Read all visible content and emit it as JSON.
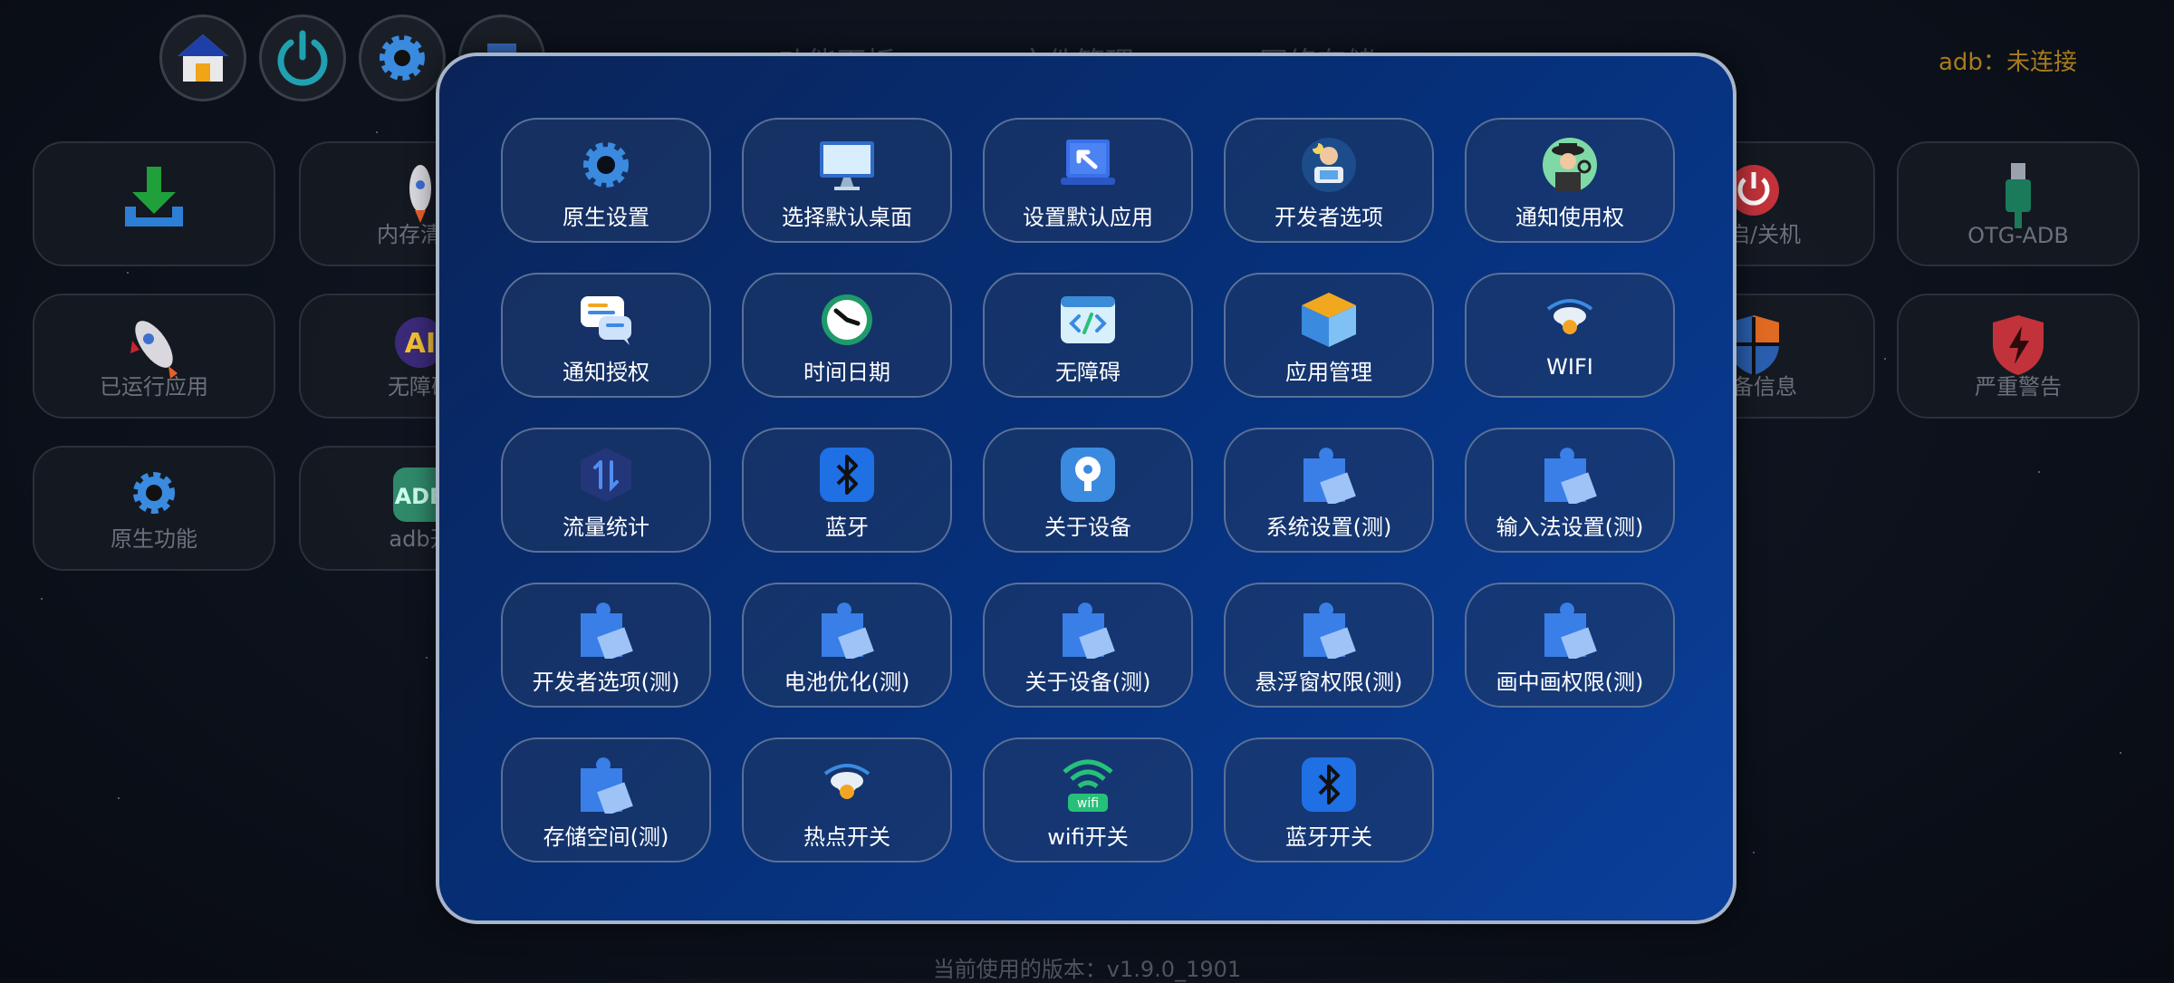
{
  "header": {
    "nav": [
      "功能面板",
      "文件管理",
      "网络存储"
    ],
    "adb_status": "adb：未连接"
  },
  "background_tiles": {
    "download": "",
    "memory_clean": "内存清理",
    "reboot": "重启/关机",
    "otg_adb": "OTG-ADB",
    "running_apps": "已运行应用",
    "accessibility": "无障碍",
    "device_info": "设备信息",
    "severe_warning": "严重警告",
    "native_functions": "原生功能",
    "adb_open": "adb开"
  },
  "modal": {
    "items": [
      {
        "label": "原生设置",
        "icon": "gear-icon"
      },
      {
        "label": "选择默认桌面",
        "icon": "monitor-icon"
      },
      {
        "label": "设置默认应用",
        "icon": "laptop-arrow-icon"
      },
      {
        "label": "开发者选项",
        "icon": "developer-icon"
      },
      {
        "label": "通知使用权",
        "icon": "detective-icon"
      },
      {
        "label": "通知授权",
        "icon": "chat-bubble-icon"
      },
      {
        "label": "时间日期",
        "icon": "clock-icon"
      },
      {
        "label": "无障碍",
        "icon": "code-window-icon"
      },
      {
        "label": "应用管理",
        "icon": "cube-icon"
      },
      {
        "label": "WIFI",
        "icon": "wifi-router-icon"
      },
      {
        "label": "流量统计",
        "icon": "traffic-arrows-icon"
      },
      {
        "label": "蓝牙",
        "icon": "bluetooth-icon"
      },
      {
        "label": "关于设备",
        "icon": "device-info-icon"
      },
      {
        "label": "系统设置(测)",
        "icon": "puzzle-icon"
      },
      {
        "label": "输入法设置(测)",
        "icon": "puzzle-icon"
      },
      {
        "label": "开发者选项(测)",
        "icon": "puzzle-icon"
      },
      {
        "label": "电池优化(测)",
        "icon": "puzzle-icon"
      },
      {
        "label": "关于设备(测)",
        "icon": "puzzle-icon"
      },
      {
        "label": "悬浮窗权限(测)",
        "icon": "puzzle-icon"
      },
      {
        "label": "画中画权限(测)",
        "icon": "puzzle-icon"
      },
      {
        "label": "存储空间(测)",
        "icon": "puzzle-icon"
      },
      {
        "label": "热点开关",
        "icon": "hotspot-icon"
      },
      {
        "label": "wifi开关",
        "icon": "wifi-icon"
      },
      {
        "label": "蓝牙开关",
        "icon": "bluetooth-icon"
      }
    ]
  },
  "footer": {
    "version": "当前使用的版本：v1.9.0_1901"
  },
  "colors": {
    "accent_blue": "#1f6fe5",
    "modal_border": "#a8b5c8",
    "adb_status": "#a67c1c"
  }
}
